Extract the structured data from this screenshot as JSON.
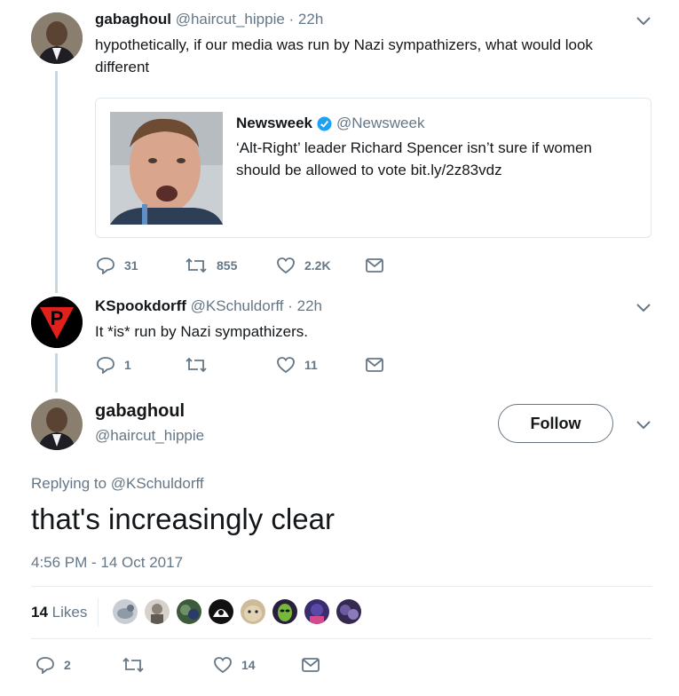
{
  "tweet1": {
    "display_name": "gabaghoul",
    "handle": "@haircut_hippie",
    "time": "· 22h",
    "text": "hypothetically, if our media was run by Nazi sympathizers, what would look different",
    "quoted": {
      "source_name": "Newsweek",
      "source_handle": "@Newsweek",
      "text": "‘Alt-Right’ leader Richard Spencer isn’t sure if women should be allowed to vote bit.ly/2z83vdz"
    },
    "replies": "31",
    "retweets": "855",
    "likes": "2.2K"
  },
  "tweet2": {
    "display_name": "KSpookdorff",
    "handle": "@KSchuldorff",
    "time": "· 22h",
    "text": "It *is* run by Nazi sympathizers.",
    "avatar_letter": "P",
    "replies": "1",
    "retweets": "",
    "likes": "11"
  },
  "main": {
    "display_name": "gabaghoul",
    "handle": "@haircut_hippie",
    "follow_label": "Follow",
    "replying_prefix": "Replying to",
    "replying_to": "@KSchuldorff",
    "text": "that's increasingly clear",
    "timestamp": "4:56 PM - 14 Oct 2017",
    "likes_count": "14",
    "likes_label": "Likes",
    "replies": "2",
    "retweets": "",
    "likes": "14"
  },
  "colors": {
    "text": "#14171a",
    "muted": "#657786",
    "verified": "#1da1f2",
    "border": "#e1e8ed",
    "thread": "#ccd6dd"
  }
}
